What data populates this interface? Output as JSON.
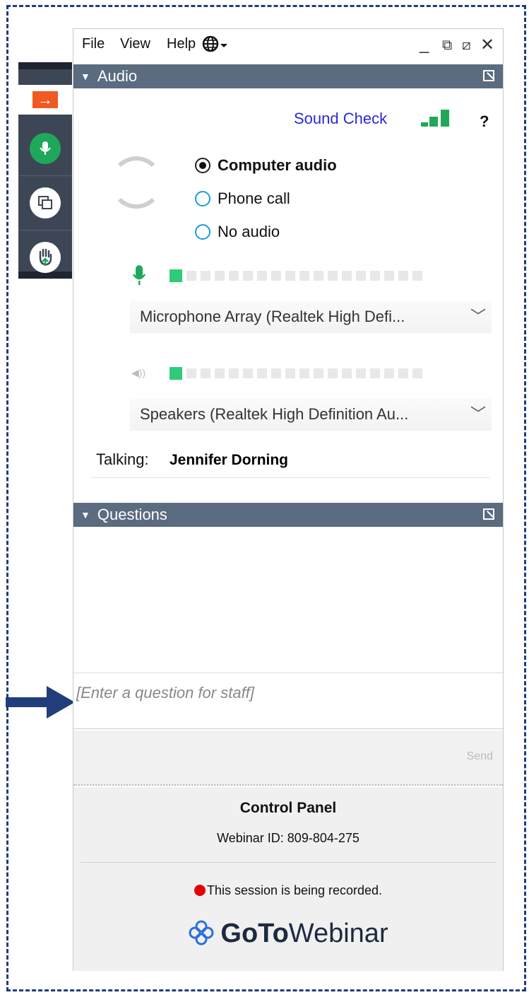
{
  "menu": {
    "file": "File",
    "view": "View",
    "help": "Help"
  },
  "audio": {
    "header": "Audio",
    "sound_check": "Sound Check",
    "help_symbol": "?",
    "options": {
      "computer": "Computer audio",
      "phone": "Phone call",
      "none": "No audio"
    },
    "selected_option": "Computer audio",
    "microphone": "Microphone Array (Realtek High Defi...",
    "speakers": "Speakers (Realtek High Definition Au...",
    "talking_label": "Talking:",
    "talking_name": "Jennifer Dorning"
  },
  "questions": {
    "header": "Questions",
    "input_placeholder": "[Enter a question for staff]",
    "send_label": "Send"
  },
  "footer": {
    "title": "Control Panel",
    "webinar_id": "Webinar ID: 809-804-275",
    "recording_notice": "This session is being recorded.",
    "brand_bold": "GoTo",
    "brand_light": "Webinar"
  },
  "colors": {
    "accent_orange": "#f05a22",
    "mic_green": "#1fa85a",
    "header_slate": "#5b6b80",
    "frame_blue": "#1f3e7a",
    "record_red": "#e60000"
  }
}
